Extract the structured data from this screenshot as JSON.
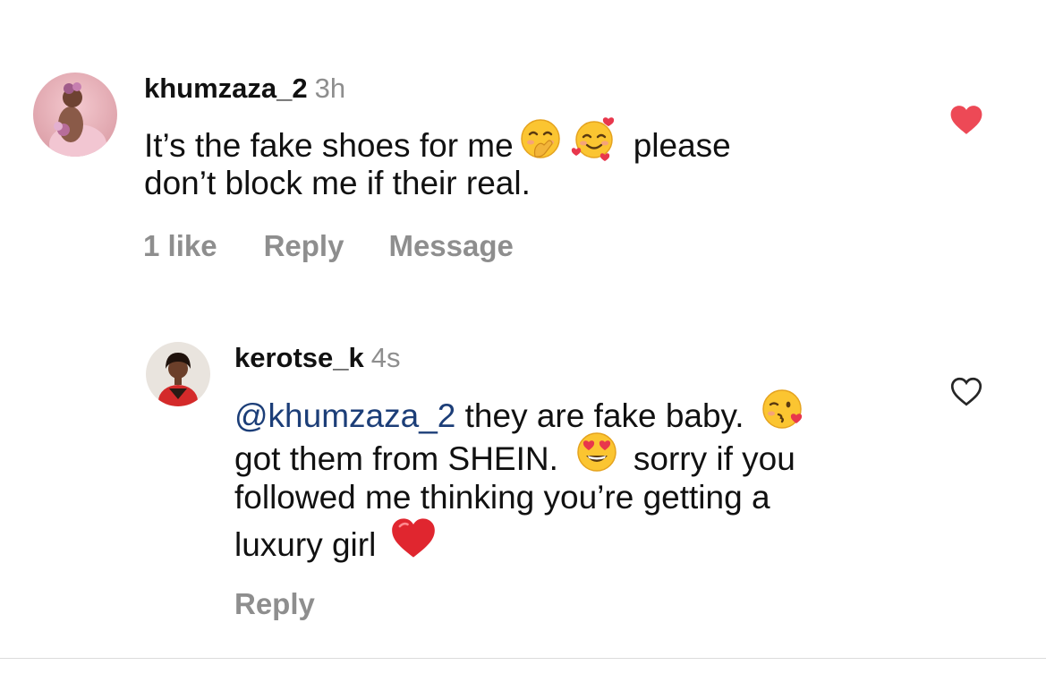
{
  "comments": [
    {
      "username": "khumzaza_2",
      "time": "3h",
      "line1_text": "It’s the fake shoes for me",
      "line1_after": "please",
      "line2": "don’t block me if their real.",
      "emojis": [
        "hand-over-mouth-emoji",
        "smiling-face-with-hearts-emoji"
      ],
      "likes": "1 like",
      "reply_label": "Reply",
      "message_label": "Message",
      "liked": true,
      "like_color": "#ed4956"
    },
    {
      "username": "kerotse_k",
      "time": "4s",
      "mention": "@khumzaza_2",
      "line1_after_mention": " they are fake baby.",
      "line2_text": "got them from SHEIN.",
      "line2_after": "sorry if you",
      "line3": "followed me thinking you’re getting a",
      "line4_text": "luxury girl",
      "emojis": [
        "face-blowing-kiss-emoji",
        "heart-eyes-emoji",
        "red-heart-emoji"
      ],
      "reply_label": "Reply",
      "liked": false,
      "mention_color": "#1c3e78"
    }
  ]
}
